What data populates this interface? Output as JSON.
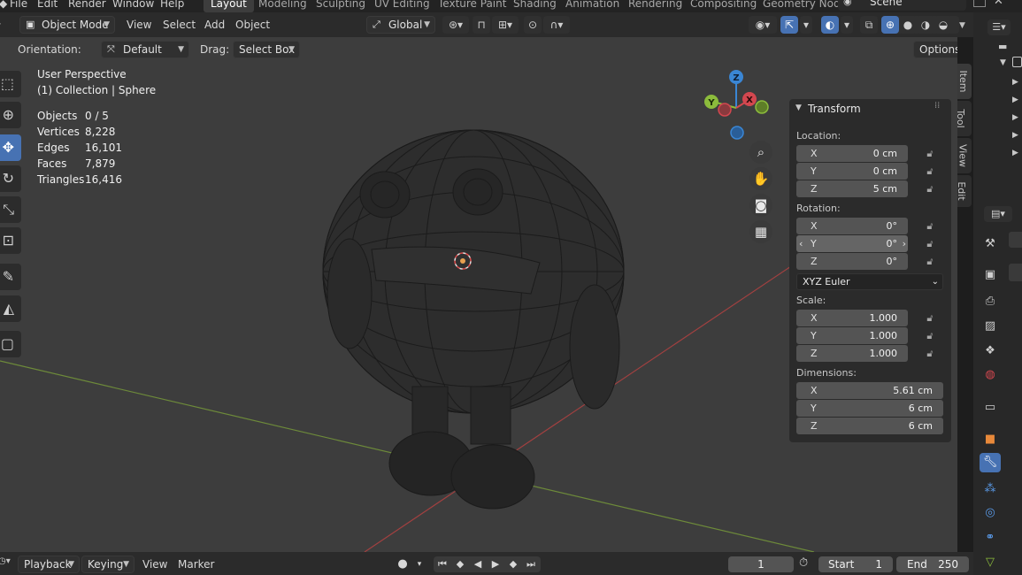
{
  "menubar": {
    "items": [
      "File",
      "Edit",
      "Render",
      "Window",
      "Help"
    ],
    "workspaces": [
      "Layout",
      "Modeling",
      "Sculpting",
      "UV Editing",
      "Texture Paint",
      "Shading",
      "Animation",
      "Rendering",
      "Compositing",
      "Geometry Nod"
    ],
    "active_workspace": "Layout",
    "scene": "Scene"
  },
  "header": {
    "mode": "Object Mode",
    "menus": [
      "View",
      "Select",
      "Add",
      "Object"
    ],
    "transform_orientation": "Global",
    "options_label": "Options"
  },
  "toolsettings": {
    "orientation_label": "Orientation:",
    "orientation_value": "Default",
    "drag_label": "Drag:",
    "drag_value": "Select Box"
  },
  "viewport": {
    "perspective": "User Perspective",
    "collection": "(1) Collection | Sphere",
    "stats": [
      {
        "label": "Objects",
        "value": "0 / 5"
      },
      {
        "label": "Vertices",
        "value": "8,228"
      },
      {
        "label": "Edges",
        "value": "16,101"
      },
      {
        "label": "Faces",
        "value": "7,879"
      },
      {
        "label": "Triangles",
        "value": "16,416"
      }
    ],
    "gizmo_axes": [
      "Z",
      "Y",
      "X"
    ]
  },
  "transform_panel": {
    "title": "Transform",
    "location_label": "Location:",
    "location": [
      {
        "axis": "X",
        "value": "0 cm"
      },
      {
        "axis": "Y",
        "value": "0 cm"
      },
      {
        "axis": "Z",
        "value": "5 cm"
      }
    ],
    "rotation_label": "Rotation:",
    "rotation": [
      {
        "axis": "X",
        "value": "0°"
      },
      {
        "axis": "Y",
        "value": "0°"
      },
      {
        "axis": "Z",
        "value": "0°"
      }
    ],
    "rotation_mode": "XYZ Euler",
    "scale_label": "Scale:",
    "scale": [
      {
        "axis": "X",
        "value": "1.000"
      },
      {
        "axis": "Y",
        "value": "1.000"
      },
      {
        "axis": "Z",
        "value": "1.000"
      }
    ],
    "dimensions_label": "Dimensions:",
    "dimensions": [
      {
        "axis": "X",
        "value": "5.61 cm"
      },
      {
        "axis": "Y",
        "value": "6 cm"
      },
      {
        "axis": "Z",
        "value": "6 cm"
      }
    ]
  },
  "sidebar_tabs": [
    "Item",
    "Tool",
    "View",
    "Edit"
  ],
  "timeline": {
    "menus": [
      "Playback",
      "Keying",
      "View",
      "Marker"
    ],
    "current_frame": "1",
    "start_label": "Start",
    "start": "1",
    "end_label": "End",
    "end": "250"
  },
  "colors": {
    "accent": "#4772b3",
    "axis_x": "#d3474f",
    "axis_y": "#8cbc3c",
    "axis_z": "#3a86d4"
  }
}
